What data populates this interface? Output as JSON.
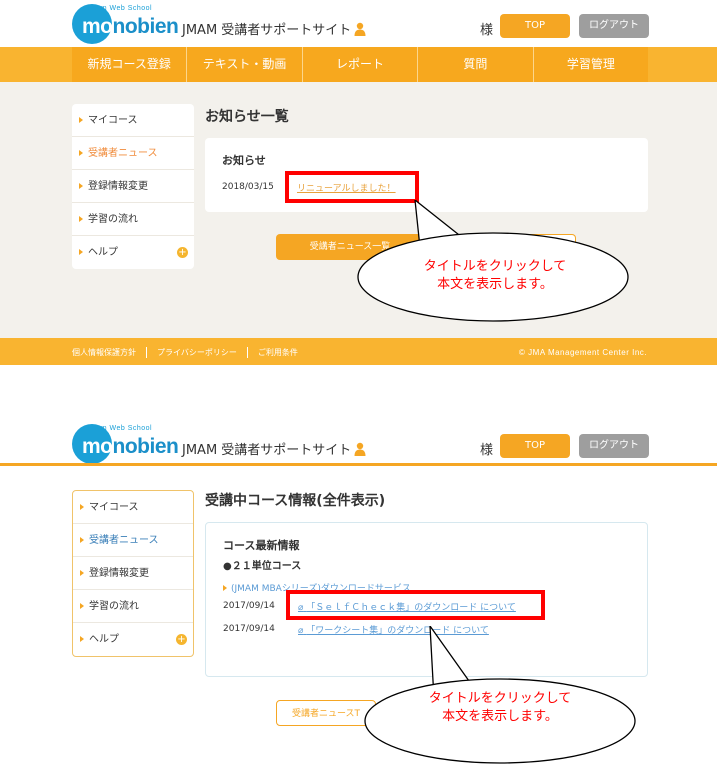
{
  "header": {
    "logo_sub": "Jmam Web School",
    "logo_main_prefix": "mo",
    "logo_main_rest": "nobien",
    "site_title": "JMAM 受講者サポートサイト",
    "user_suffix": "様",
    "top_button": "TOP",
    "logout_button": "ログアウト"
  },
  "nav": [
    "新規コース登録",
    "テキスト・動画",
    "レポート",
    "質問",
    "学習管理"
  ],
  "sidebar": {
    "items": [
      {
        "label": "マイコース"
      },
      {
        "label": "受講者ニュース"
      },
      {
        "label": "登録情報変更"
      },
      {
        "label": "学習の流れ"
      },
      {
        "label": "ヘルプ"
      }
    ],
    "plus_symbol": "+"
  },
  "panel1": {
    "page_heading": "お知らせ一覧",
    "card_title": "お知らせ",
    "news": [
      {
        "date": "2018/03/15",
        "title": "リニューアルしました！"
      }
    ],
    "list_button": "受講者ニュース一覧",
    "callout_line1": "タイトルをクリックして",
    "callout_line2": "本文を表示します。"
  },
  "footer": {
    "links": [
      "個人情報保護方針",
      "プライバシーポリシー",
      "ご利用条件"
    ],
    "copyright": "© JMA Management Center Inc."
  },
  "panel2": {
    "page_heading": "受講中コース情報(全件表示)",
    "card_title": "コース最新情報",
    "section_title": "●２１単位コース",
    "course_name": "(JMAM MBAシリーズ)ダウンロードサービス",
    "items": [
      {
        "date": "2017/09/14",
        "title": "「ＳｅｌｆＣｈｅｃｋ集」のダウンロード について"
      },
      {
        "date": "2017/09/14",
        "title": "「ワークシート集」のダウンロード について"
      }
    ],
    "button": "受講者ニュースT",
    "callout_line1": "タイトルをクリックして",
    "callout_line2": "本文を表示します。"
  },
  "colors": {
    "brand_orange": "#f9b430",
    "logo_blue": "#1ba0d7",
    "annotation_red": "#ff0000"
  }
}
